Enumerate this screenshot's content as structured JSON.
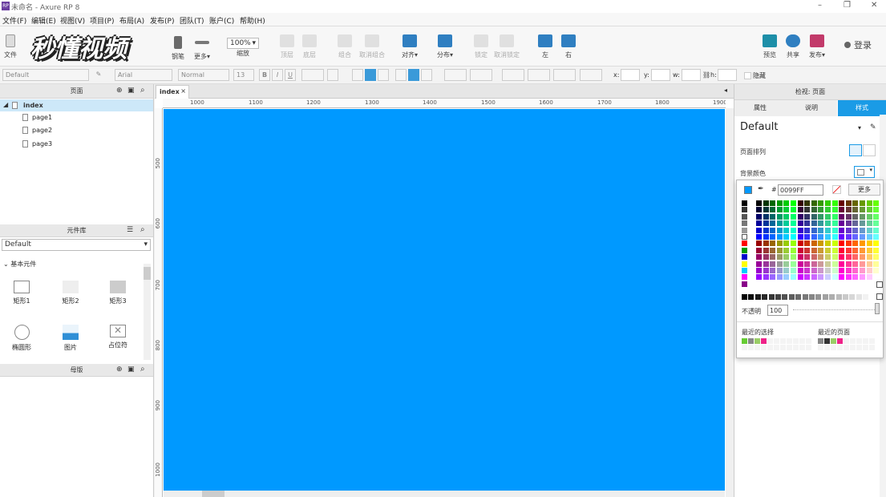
{
  "window": {
    "title": "未命名 - Axure RP 8",
    "app_icon": "RP",
    "controls": [
      "–",
      "❐",
      "✕"
    ]
  },
  "menu": [
    "文件(F)",
    "编辑(E)",
    "视图(V)",
    "项目(P)",
    "布局(A)",
    "发布(P)",
    "团队(T)",
    "账户(C)",
    "帮助(H)"
  ],
  "watermark": "秒懂视频",
  "toolbar": {
    "file": "文件",
    "pen": "钢笔",
    "more": "更多▾",
    "zoom_value": "100%",
    "zoom_label": "缩放",
    "top": "顶层",
    "bottom": "底层",
    "group": "组合",
    "ungroup": "取消组合",
    "align": "对齐▾",
    "distribute": "分布▾",
    "lock": "锁定",
    "unlock": "取消锁定",
    "left": "左",
    "right": "右",
    "preview": "预览",
    "share": "共享",
    "publish": "发布▾",
    "login": "登录"
  },
  "formatbar": {
    "style": "Default",
    "font": "Arial",
    "weight": "Normal",
    "size": "13",
    "bold": "B",
    "italic": "I",
    "underline": "U",
    "x_label": "x:",
    "y_label": "y:",
    "w_label": "w:",
    "h_label": "h:",
    "hidden": "隐藏"
  },
  "pages_panel": {
    "title": "页面",
    "root": "index",
    "pages": [
      "page1",
      "page2",
      "page3"
    ]
  },
  "library_panel": {
    "title": "元件库",
    "selected": "Default",
    "group": "基本元件",
    "widgets": [
      "矩形1",
      "矩形2",
      "矩形3",
      "椭圆形",
      "图片",
      "占位符"
    ]
  },
  "masters_panel": {
    "title": "母版"
  },
  "canvas": {
    "tab": "index",
    "color": "#0099FF",
    "hruler": [
      "1000",
      "1100",
      "1200",
      "1300",
      "1400",
      "1500",
      "1600",
      "1700",
      "1800",
      "1900"
    ],
    "vruler": [
      "500",
      "600",
      "700",
      "800",
      "900",
      "1000"
    ]
  },
  "inspector": {
    "title": "检视: 页面",
    "tabs": [
      "属性",
      "说明",
      "样式"
    ],
    "active_tab": "样式",
    "style_name": "Default",
    "page_align_label": "页面排列",
    "bg_color_label": "背景颜色"
  },
  "color_picker": {
    "hash": "#",
    "hex": "0099FF",
    "more": "更多",
    "opacity_label": "不透明",
    "opacity": "100",
    "recent_selected": "最近的选择",
    "recent_page": "最近的页面"
  }
}
